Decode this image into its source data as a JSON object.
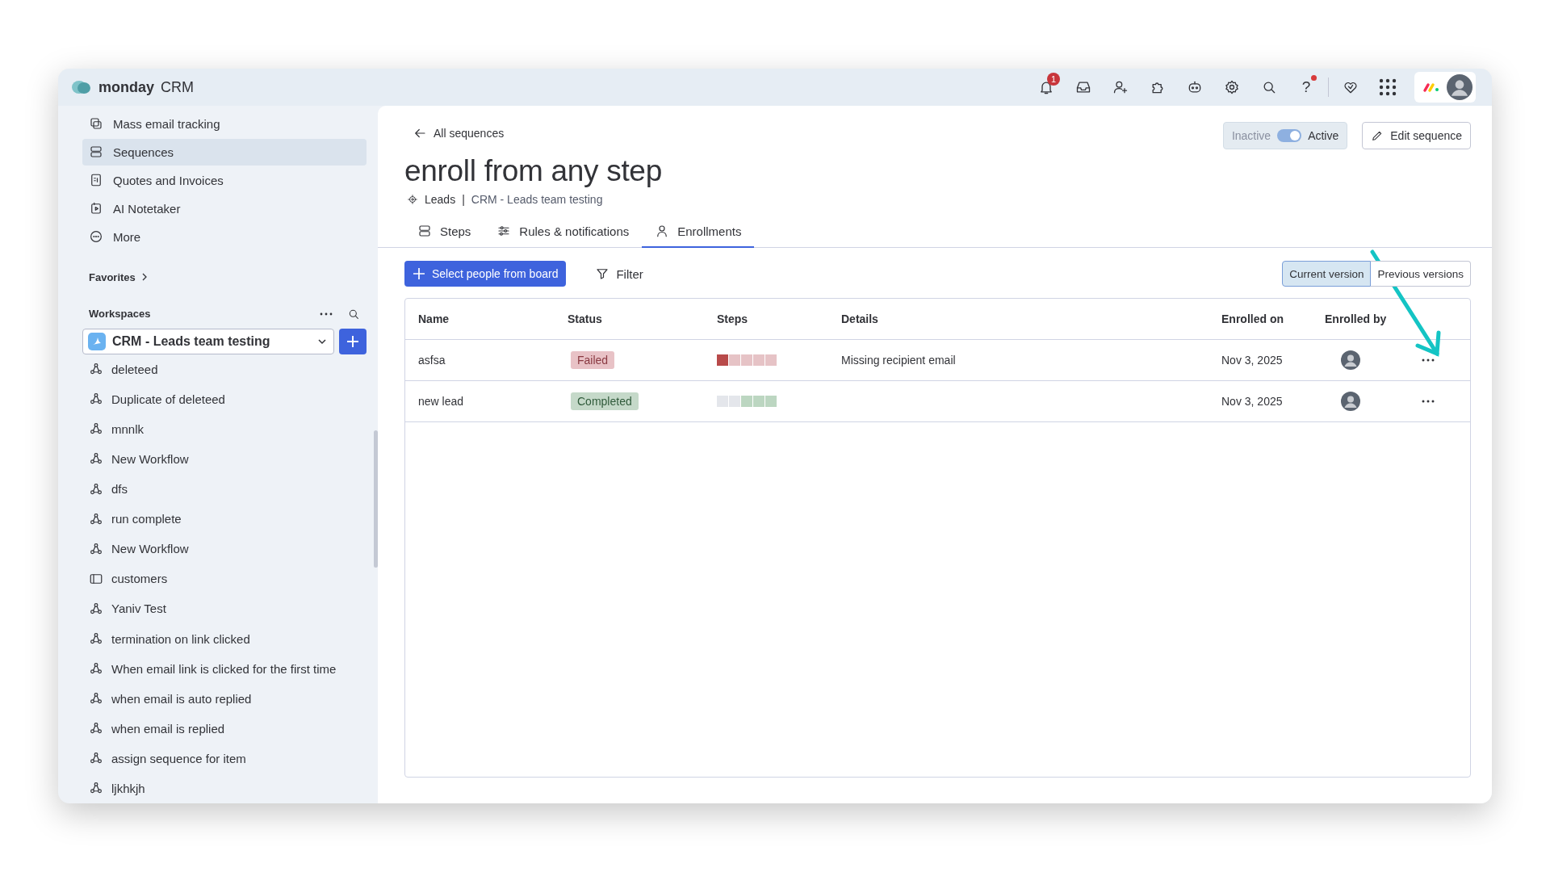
{
  "app": {
    "logo": "monday",
    "product": "CRM",
    "notification_count": "1",
    "help": "?"
  },
  "sidebar": {
    "items": [
      {
        "label": "Mass email tracking",
        "kind": "tracking",
        "selected": false
      },
      {
        "label": "Sequences",
        "kind": "sequences",
        "selected": true
      },
      {
        "label": "Quotes and Invoices",
        "kind": "quotes",
        "selected": false
      },
      {
        "label": "AI Notetaker",
        "kind": "notetaker",
        "selected": false
      },
      {
        "label": "More",
        "kind": "more",
        "selected": false
      }
    ],
    "favorites": "Favorites",
    "workspaces": "Workspaces",
    "workspace": "CRM - Leads team testing",
    "boards": [
      {
        "label": "deleteed",
        "kind": "workflow"
      },
      {
        "label": "Duplicate of deleteed",
        "kind": "workflow"
      },
      {
        "label": "mnnlk",
        "kind": "workflow"
      },
      {
        "label": "New Workflow",
        "kind": "workflow"
      },
      {
        "label": "dfs",
        "kind": "workflow"
      },
      {
        "label": "run complete",
        "kind": "workflow"
      },
      {
        "label": "New Workflow",
        "kind": "workflow"
      },
      {
        "label": "customers",
        "kind": "board"
      },
      {
        "label": "Yaniv Test",
        "kind": "workflow"
      },
      {
        "label": "termination on link clicked",
        "kind": "workflow"
      },
      {
        "label": "When email link is clicked for the first time",
        "kind": "workflow"
      },
      {
        "label": "when email is auto replied",
        "kind": "workflow"
      },
      {
        "label": "when email is replied",
        "kind": "workflow"
      },
      {
        "label": "assign sequence for item",
        "kind": "workflow"
      },
      {
        "label": "ljkhkjh",
        "kind": "workflow"
      }
    ]
  },
  "page": {
    "back": "All sequences",
    "title": "enroll from any step",
    "entity": "Leads",
    "separator": "|",
    "workspace": "CRM - Leads team testing",
    "toggle": {
      "off_label": "Inactive",
      "on_label": "Active",
      "on": true
    },
    "edit_button": "Edit sequence",
    "tabs": [
      {
        "label": "Steps",
        "kind": "steps",
        "selected": false
      },
      {
        "label": "Rules & notifications",
        "kind": "rules",
        "selected": false
      },
      {
        "label": "Enrollments",
        "kind": "person",
        "selected": true
      }
    ],
    "add_button": "Select people from board",
    "filter_button": "Filter",
    "versions": [
      {
        "label": "Current version",
        "selected": true
      },
      {
        "label": "Previous versions",
        "selected": false
      }
    ]
  },
  "table": {
    "columns": [
      "Name",
      "Status",
      "Steps",
      "Details",
      "Enrolled on",
      "Enrolled by"
    ],
    "rows": [
      {
        "name": "asfsa",
        "status": {
          "label": "Failed",
          "kind": "failed"
        },
        "steps": [
          {
            "kind": "failed"
          },
          {
            "kind": "pending"
          },
          {
            "kind": "pending"
          },
          {
            "kind": "pending"
          },
          {
            "kind": "pending"
          }
        ],
        "details": "Missing recipient email",
        "enrolled_on": "Nov 3, 2025"
      },
      {
        "name": "new lead",
        "status": {
          "label": "Completed",
          "kind": "completed"
        },
        "steps": [
          {
            "kind": "skipped"
          },
          {
            "kind": "skipped"
          },
          {
            "kind": "done"
          },
          {
            "kind": "done"
          },
          {
            "kind": "done"
          }
        ],
        "enrolled_on": "Nov 3, 2025"
      }
    ]
  }
}
